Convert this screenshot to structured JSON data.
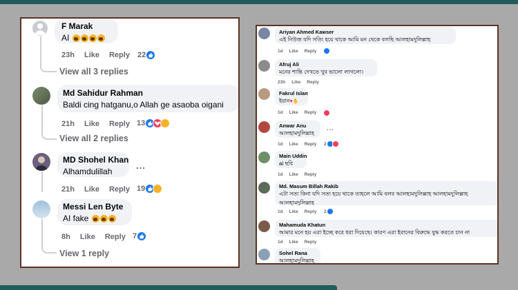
{
  "left": {
    "comments": [
      {
        "name": "F Marak",
        "text": "AI",
        "time": "23h",
        "like": "Like",
        "reply": "Reply",
        "count": "22",
        "view_replies": "View all 3 replies"
      },
      {
        "name": "Md Sahidur Rahman",
        "text": "Baldi cing hatganu,o Allah ge asaoba oigani",
        "time": "21h",
        "like": "Like",
        "reply": "Reply",
        "count": "13",
        "view_replies": "View all 2 replies"
      },
      {
        "name": "MD Shohel Khan",
        "text": "Alhamdulillah",
        "time": "21h",
        "like": "Like",
        "reply": "Reply",
        "count": "19"
      },
      {
        "name": "Messi Len Byte",
        "text": "AI fake",
        "time": "8h",
        "like": "Like",
        "reply": "Reply",
        "count": "7",
        "view_replies": "View 1 reply"
      }
    ],
    "more": "..."
  },
  "right": {
    "comments": [
      {
        "name": "Ariyan Ahmed Kawser",
        "text": "এই নিউজ যদি সত্যি হয়ে থাকে আমি মন থেকে বলছি আলহামদুলিল্লাহ",
        "time": "1d",
        "like": "Like",
        "reply": "Reply"
      },
      {
        "name": "Afruj Ali",
        "text": "মনের শান্তি দেখতে খুব ভালো লাগলো।",
        "time": "23h",
        "like": "Like",
        "reply": "Reply"
      },
      {
        "name": "Fakrul Islam",
        "text": "ইরান",
        "time": "1d",
        "like": "Like",
        "reply": "Reply"
      },
      {
        "name": "Anwar Anu",
        "text": "আলহামদুলিল্লাহ",
        "time": "1d",
        "like": "Like",
        "reply": "Reply",
        "count": "2"
      },
      {
        "name": "Main Uddin",
        "text": "ai ছবি",
        "time": "1d",
        "like": "Like",
        "reply": "Reply"
      },
      {
        "name": "Md. Masum Billah Rakib",
        "text": "এটা সত্য কিনা যদি সত্য হয়ে থাকে তাহলে আমি বলব আলহামদুলিল্লাহ আলহামদুলিল্লাহ",
        "text2": "আলহামদুলিল্লাহ",
        "time": "1d",
        "like": "Like",
        "reply": "Reply",
        "count": "2"
      },
      {
        "name": "Mahamuda Khatun",
        "text": "আমার মনে হয় এরা ইচ্ছে করে ধরা দিয়েছে। কারণ এরা ইরানের বিরুদ্ধে যুদ্ধ করতে চান না",
        "time": "1d",
        "like": "Like",
        "reply": "Reply"
      },
      {
        "name": "Sohel Rana",
        "text": "আলহামদুলিল্লাহ"
      }
    ],
    "more": "..."
  },
  "colors": {
    "accent": "#1f5e5a",
    "frame": "#5a3325",
    "like": "#1877f2",
    "haha": "#f7b125",
    "heart": "#f33e58"
  }
}
